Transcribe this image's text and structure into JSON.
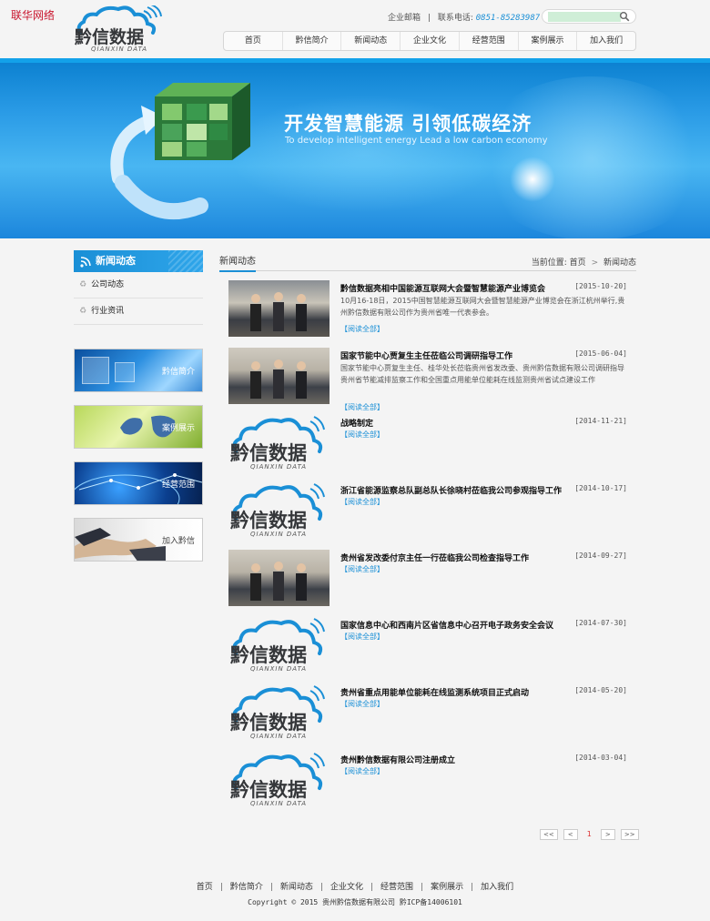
{
  "corner_label": "联华网络",
  "logo": {
    "name": "黔信数据",
    "sub": "QIANXIN DATA"
  },
  "header": {
    "email_label": "企业邮箱",
    "phone_label": "联系电话:",
    "phone": "0851-85283987"
  },
  "search": {
    "value": ""
  },
  "nav": {
    "items": [
      "首页",
      "黔信简介",
      "新闻动态",
      "企业文化",
      "经营范围",
      "案例展示",
      "加入我们"
    ]
  },
  "banner": {
    "headline": "开发智慧能源 引领低碳经济",
    "subline": "To develop intelligent energy Lead a low carbon economy"
  },
  "sidebar": {
    "title": "新闻动态",
    "items": [
      "公司动态",
      "行业资讯"
    ],
    "promo": [
      "黔信简介",
      "案例展示",
      "经营范围",
      "加入黔信"
    ]
  },
  "content": {
    "section_title": "新闻动态",
    "breadcrumb_prefix": "当前位置:",
    "breadcrumb_home": "首页",
    "breadcrumb_sep": ">",
    "breadcrumb_current": "新闻动态",
    "read_more": "【阅读全部】",
    "news": [
      {
        "title": "黔信数据亮相中国能源互联网大会暨智慧能源产业博览会",
        "date": "[2015-10-20]",
        "desc": "10月16-18日，2015中国智慧能源互联网大会暨智慧能源产业博览会在浙江杭州举行,贵州黔信数据有限公司作为贵州省唯一代表参会。",
        "thumb": "photo"
      },
      {
        "title": "国家节能中心贾复生主任莅临公司调研指导工作",
        "date": "[2015-06-04]",
        "desc": "国家节能中心贾复生主任、桂华处长莅临贵州省发改委、贵州黔信数据有限公司调研指导贵州省节能减排监察工作和全国重点用能单位能耗在线监测贵州省试点建设工作",
        "thumb": "photo"
      },
      {
        "title": "战略制定",
        "date": "[2014-11-21]",
        "desc": "",
        "thumb": "logo"
      },
      {
        "title": "浙江省能源监察总队副总队长徐晓村莅临我公司参观指导工作",
        "date": "[2014-10-17]",
        "desc": "",
        "thumb": "logo"
      },
      {
        "title": "贵州省发改委付京主任一行莅临我公司检查指导工作",
        "date": "[2014-09-27]",
        "desc": "",
        "thumb": "photo"
      },
      {
        "title": "国家信息中心和西南片区省信息中心召开电子政务安全会议",
        "date": "[2014-07-30]",
        "desc": "",
        "thumb": "logo"
      },
      {
        "title": "贵州省重点用能单位能耗在线监测系统项目正式启动",
        "date": "[2014-05-20]",
        "desc": "",
        "thumb": "logo"
      },
      {
        "title": "贵州黔信数据有限公司注册成立",
        "date": "[2014-03-04]",
        "desc": "",
        "thumb": "logo"
      }
    ]
  },
  "pager": {
    "first": "<<",
    "prev": "<",
    "current": "1",
    "next": ">",
    "last": ">>"
  },
  "footer": {
    "links": [
      "首页",
      "黔信简介",
      "新闻动态",
      "企业文化",
      "经营范围",
      "案例展示",
      "加入我们"
    ],
    "copyright": "Copyright © 2015 贵州黔信数据有限公司 黔ICP备14006101"
  },
  "colors": {
    "accent": "#1a8fd6",
    "banner": "#2a9be6",
    "page_num": "#dd3333"
  }
}
